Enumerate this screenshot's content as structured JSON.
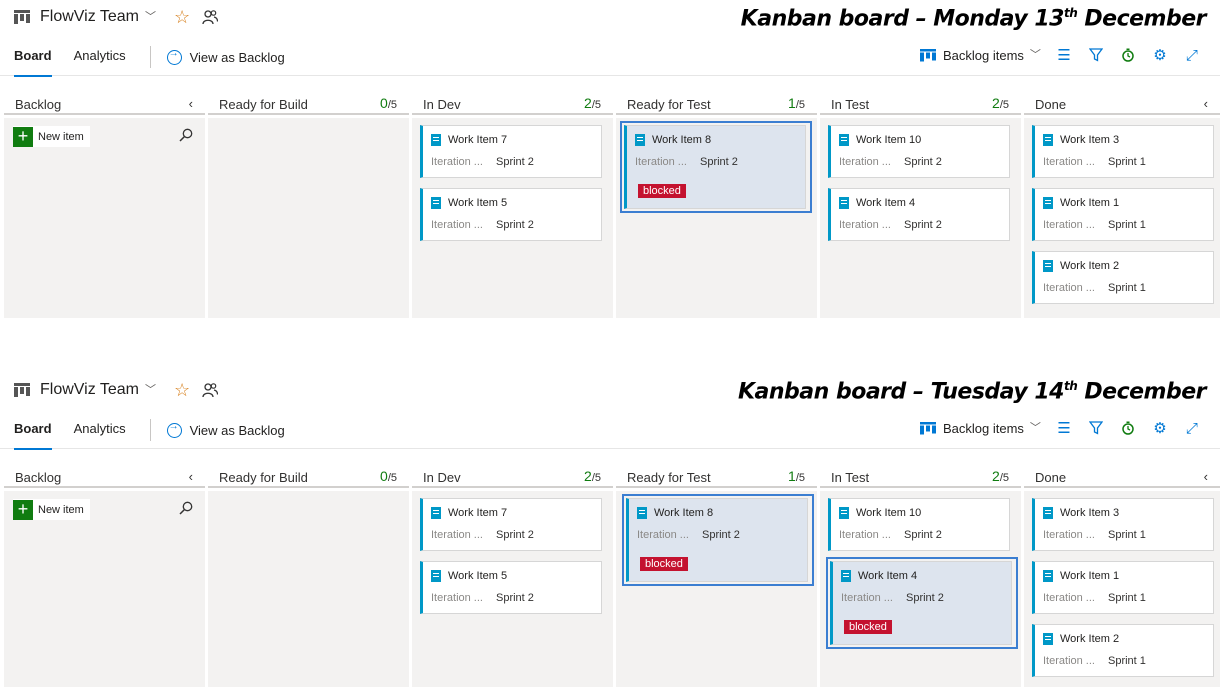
{
  "boards": [
    {
      "team": "FlowViz Team",
      "title": "Kanban board – Monday 13",
      "title_sup": "th",
      "title_end": " December",
      "tabs": [
        "Board",
        "Analytics"
      ],
      "view_as_backlog": "View as Backlog",
      "backlog_items": "Backlog items",
      "columns": [
        {
          "name": "Backlog",
          "new_item": "New item"
        },
        {
          "name": "Ready for Build",
          "count": "0",
          "limit": "/5"
        },
        {
          "name": "In Dev",
          "count": "2",
          "limit": "/5"
        },
        {
          "name": "Ready for Test",
          "count": "1",
          "limit": "/5"
        },
        {
          "name": "In Test",
          "count": "2",
          "limit": "/5"
        },
        {
          "name": "Done"
        }
      ],
      "cards": {
        "in_dev": [
          {
            "title": "Work Item 7",
            "iteration": "Iteration ...",
            "sprint": "Sprint 2"
          },
          {
            "title": "Work Item 5",
            "iteration": "Iteration ...",
            "sprint": "Sprint 2"
          }
        ],
        "ready_for_test": [
          {
            "title": "Work Item 8",
            "iteration": "Iteration ...",
            "sprint": "Sprint 2",
            "tag": "blocked"
          }
        ],
        "in_test": [
          {
            "title": "Work Item 10",
            "iteration": "Iteration ...",
            "sprint": "Sprint 2"
          },
          {
            "title": "Work Item 4",
            "iteration": "Iteration ...",
            "sprint": "Sprint 2"
          }
        ],
        "done": [
          {
            "title": "Work Item 3",
            "iteration": "Iteration ...",
            "sprint": "Sprint 1"
          },
          {
            "title": "Work Item 1",
            "iteration": "Iteration ...",
            "sprint": "Sprint 1"
          },
          {
            "title": "Work Item 2",
            "iteration": "Iteration ...",
            "sprint": "Sprint 1"
          }
        ]
      }
    },
    {
      "team": "FlowViz Team",
      "title": "Kanban board – Tuesday 14",
      "title_sup": "th",
      "title_end": " December",
      "tabs": [
        "Board",
        "Analytics"
      ],
      "view_as_backlog": "View as Backlog",
      "backlog_items": "Backlog items",
      "columns": [
        {
          "name": "Backlog",
          "new_item": "New item"
        },
        {
          "name": "Ready for Build",
          "count": "0",
          "limit": "/5"
        },
        {
          "name": "In Dev",
          "count": "2",
          "limit": "/5"
        },
        {
          "name": "Ready for Test",
          "count": "1",
          "limit": "/5"
        },
        {
          "name": "In Test",
          "count": "2",
          "limit": "/5"
        },
        {
          "name": "Done"
        }
      ],
      "cards": {
        "in_dev": [
          {
            "title": "Work Item 7",
            "iteration": "Iteration ...",
            "sprint": "Sprint 2"
          },
          {
            "title": "Work Item 5",
            "iteration": "Iteration ...",
            "sprint": "Sprint 2"
          }
        ],
        "ready_for_test": [
          {
            "title": "Work Item 8",
            "iteration": "Iteration ...",
            "sprint": "Sprint 2",
            "tag": "blocked"
          }
        ],
        "in_test": [
          {
            "title": "Work Item 10",
            "iteration": "Iteration ...",
            "sprint": "Sprint 2"
          },
          {
            "title": "Work Item 4",
            "iteration": "Iteration ...",
            "sprint": "Sprint 2",
            "tag": "blocked"
          }
        ],
        "done": [
          {
            "title": "Work Item 3",
            "iteration": "Iteration ...",
            "sprint": "Sprint 1"
          },
          {
            "title": "Work Item 1",
            "iteration": "Iteration ...",
            "sprint": "Sprint 1"
          },
          {
            "title": "Work Item 2",
            "iteration": "Iteration ...",
            "sprint": "Sprint 1"
          }
        ]
      }
    }
  ],
  "colors": {
    "accent": "#0078d4",
    "card_stripe": "#0098c7",
    "blocked": "#c4122f",
    "wip_ok": "#107c10",
    "star": "#d67f1b"
  },
  "icons": [
    "board-icon",
    "chevron-down-icon",
    "star-icon",
    "people-icon",
    "arrow-circle-icon",
    "backlog-list-icon",
    "settings-sliders-icon",
    "filter-icon",
    "timer-icon",
    "gear-icon",
    "fullscreen-icon",
    "chevron-left-icon",
    "plus-icon",
    "search-icon",
    "book-icon"
  ]
}
